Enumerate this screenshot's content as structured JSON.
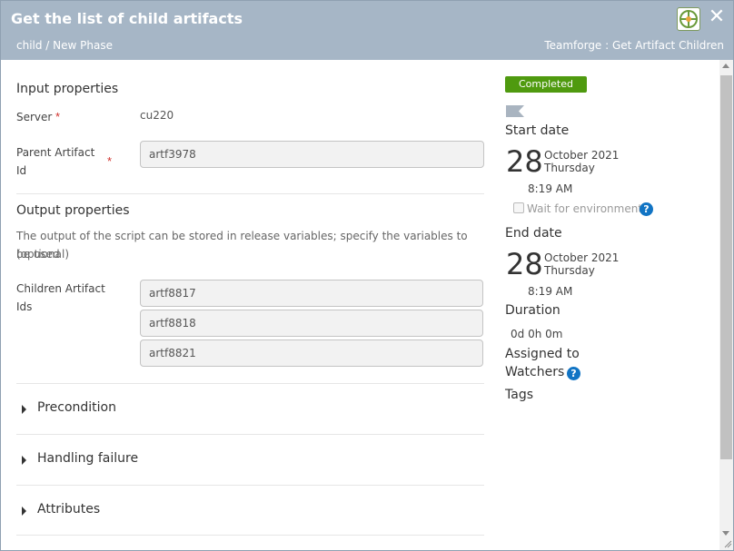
{
  "header": {
    "title": "Get the list of child artifacts",
    "breadcrumb": "child / New Phase",
    "plugin_label": "Teamforge : Get Artifact Children",
    "close_glyph": "✕"
  },
  "input_properties": {
    "title": "Input properties",
    "server_label": "Server",
    "server_value": "cu220",
    "parent_label_line1": "Parent Artifact",
    "parent_label_line2": "Id",
    "parent_value": "artf3978",
    "required_mark": "*"
  },
  "output_properties": {
    "title": "Output properties",
    "hint_line1": "The output of the script can be stored in release variables; specify the variables to be used",
    "hint_line2": "(optional)",
    "children_label_line1": "Children Artifact",
    "children_label_line2": "Ids",
    "children_values": [
      "artf8817",
      "artf8818",
      "artf8821"
    ]
  },
  "sections": {
    "precondition": "Precondition",
    "handling_failure": "Handling failure",
    "attributes": "Attributes"
  },
  "status": {
    "badge": "Completed",
    "badge_color": "#4f9a0f",
    "flag_icon": "flag-icon"
  },
  "start_date": {
    "heading": "Start date",
    "day": "28",
    "month_year": "October 2021",
    "weekday": "Thursday",
    "time": "8:19 AM",
    "wait_label": "Wait for environment"
  },
  "end_date": {
    "heading": "End date",
    "day": "28",
    "month_year": "October 2021",
    "weekday": "Thursday",
    "time": "8:19 AM"
  },
  "duration": {
    "heading": "Duration",
    "value": "0d 0h 0m"
  },
  "assigned_to": "Assigned to",
  "watchers": "Watchers",
  "tags": "Tags",
  "help_glyph": "?",
  "colors": {
    "header": "#a6b6c6",
    "accent_blue": "#1174c4",
    "required_red": "#d0312d"
  }
}
